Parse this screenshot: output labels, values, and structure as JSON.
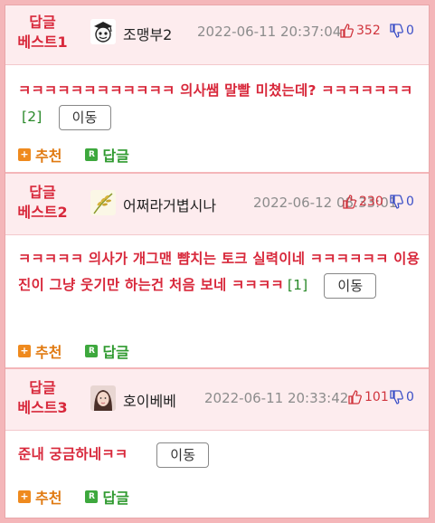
{
  "comments": [
    {
      "best_label_1": "답글",
      "best_label_2": "베스트1",
      "nick": "조맹부2",
      "avatar_icon": "cartoon-face-icon",
      "date": "2022-06-11 20:37:04",
      "likes": "352",
      "dislikes": "0",
      "text": "ㅋㅋㅋㅋㅋㅋㅋㅋㅋㅋㅋㅋ 의사쌤 말빨 미쳤는데? ㅋㅋㅋㅋㅋㅋㅋ",
      "reply_count": "[2]",
      "move_label": "이동",
      "recommend_label": "추천",
      "reply_label": "답글"
    },
    {
      "best_label_1": "답글",
      "best_label_2": "베스트2",
      "nick": "어쩌라거볍시나",
      "avatar_icon": "rice-plant-icon",
      "date": "2022-06-12 08:33:01",
      "likes": "230",
      "dislikes": "0",
      "text": "ㅋㅋㅋㅋㅋ 의사가 개그맨 뺨치는 토크 실력이네 ㅋㅋㅋㅋㅋㅋ 이용진이 그냥 웃기만 하는건 처음 보네 ㅋㅋㅋㅋ",
      "reply_count": "[1]",
      "move_label": "이동",
      "recommend_label": "추천",
      "reply_label": "답글"
    },
    {
      "best_label_1": "답글",
      "best_label_2": "베스트3",
      "nick": "호이베베",
      "avatar_icon": "profile-photo-icon",
      "date": "2022-06-11 20:33:42",
      "likes": "101",
      "dislikes": "0",
      "text": "준내 궁금하네ㅋㅋ",
      "reply_count": "",
      "move_label": "이동",
      "recommend_label": "추천",
      "reply_label": "답글"
    }
  ],
  "colors": {
    "accent_red": "#d8283b",
    "header_bg": "#fdecee",
    "border_pink": "#f4b6b9",
    "recommend_orange": "#e07a12",
    "reply_green": "#2f9a2f",
    "dislike_blue": "#3b4fc7"
  }
}
